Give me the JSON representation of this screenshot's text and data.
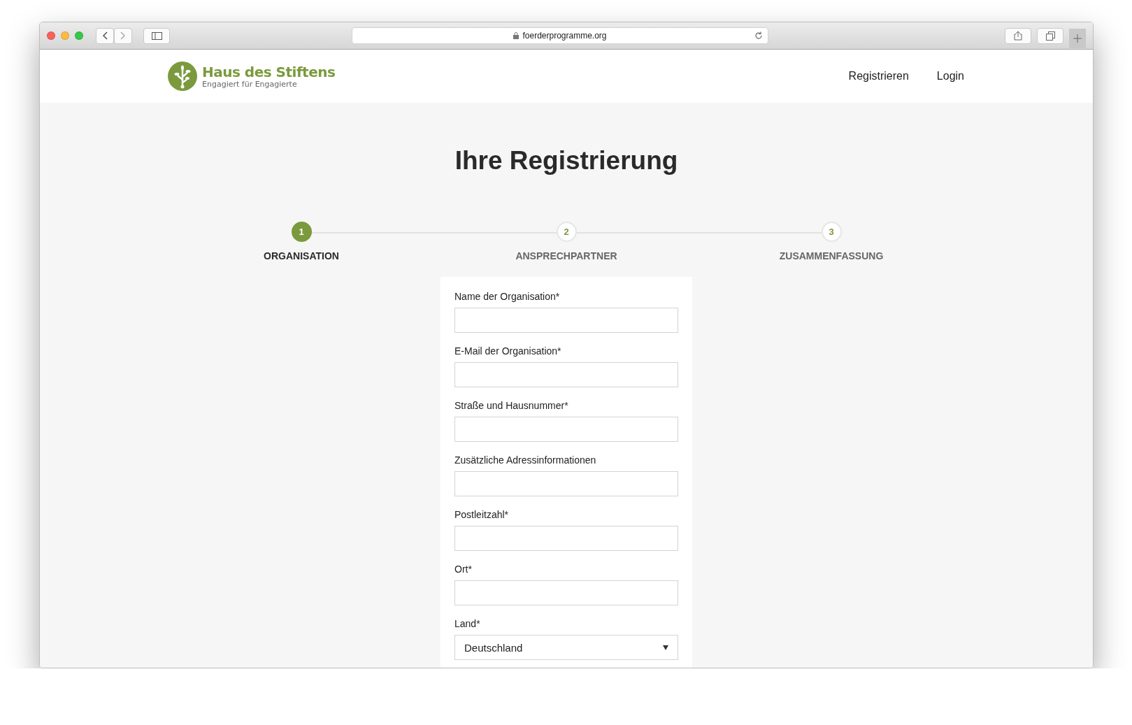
{
  "browser": {
    "url": "foerderprogramme.org"
  },
  "header": {
    "logo": {
      "title": "Haus des Stiftens",
      "tagline": "Engagiert für Engagierte"
    },
    "nav": [
      "Registrieren",
      "Login"
    ]
  },
  "title": "Ihre Registrierung",
  "steps": [
    {
      "number": "1",
      "label": "ORGANISATION",
      "selected": true
    },
    {
      "number": "2",
      "label": "ANSPRECHPARTNER",
      "selected": false
    },
    {
      "number": "3",
      "label": "ZUSAMMENFASSUNG",
      "selected": false
    }
  ],
  "form": {
    "fields": [
      {
        "kind": "text",
        "label": "Name der Organisation*"
      },
      {
        "kind": "text",
        "label": "E-Mail der Organisation*"
      },
      {
        "kind": "text",
        "label": "Straße und Hausnummer*"
      },
      {
        "kind": "text",
        "label": "Zusätzliche Adressinformationen"
      },
      {
        "kind": "text",
        "label": "Postleitzahl*"
      },
      {
        "kind": "text",
        "label": "Ort*"
      },
      {
        "kind": "select",
        "label": "Land*",
        "value": "Deutschland"
      }
    ]
  }
}
